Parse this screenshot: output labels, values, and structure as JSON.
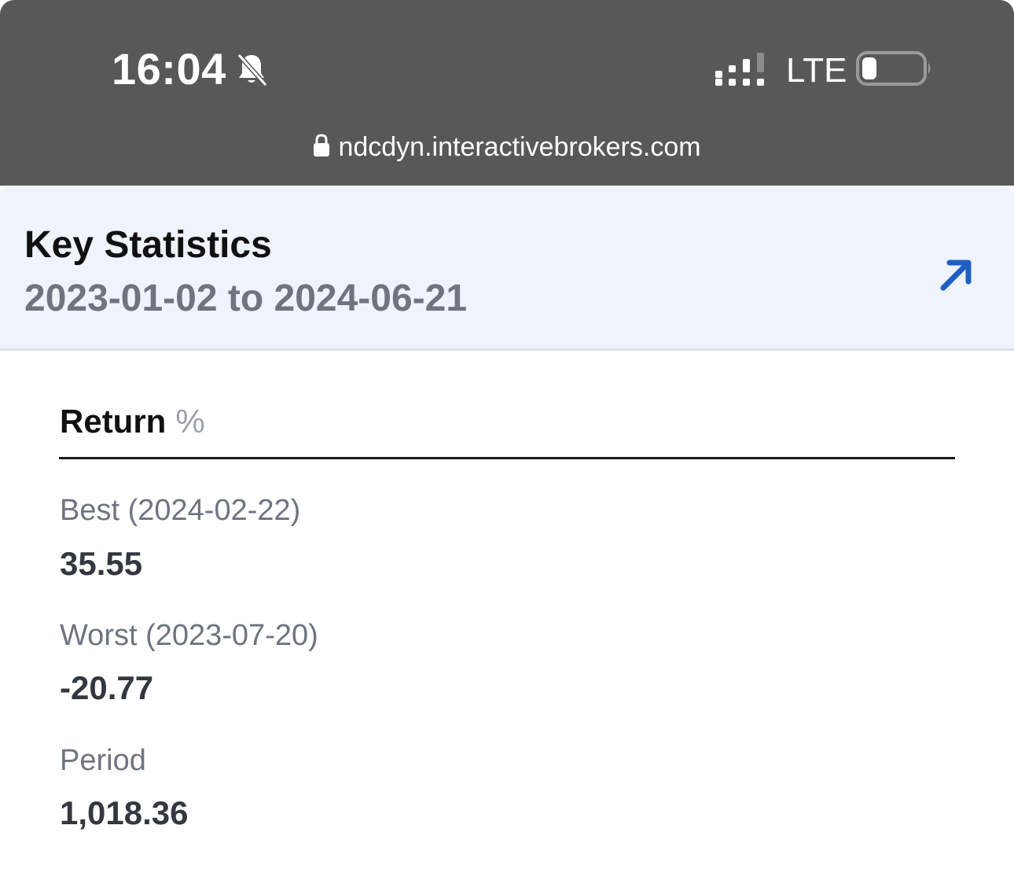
{
  "status_bar": {
    "time": "16:04",
    "network": "LTE",
    "icons": [
      "bell-slash-icon",
      "signal-icon",
      "battery-icon"
    ]
  },
  "browser": {
    "url": "ndcdyn.interactivebrokers.com",
    "icon": "lock-icon"
  },
  "header": {
    "title": "Key Statistics",
    "date_range": "2023-01-02 to 2024-06-21",
    "action_icon": "arrow-up-right-icon",
    "accent_color": "#1f5fc4"
  },
  "section": {
    "title": "Return",
    "unit": "%"
  },
  "stats": [
    {
      "label": "Best (2024-02-22)",
      "value": "35.55"
    },
    {
      "label": "Worst (2023-07-20)",
      "value": "-20.77"
    },
    {
      "label": "Period",
      "value": "1,018.36"
    }
  ]
}
